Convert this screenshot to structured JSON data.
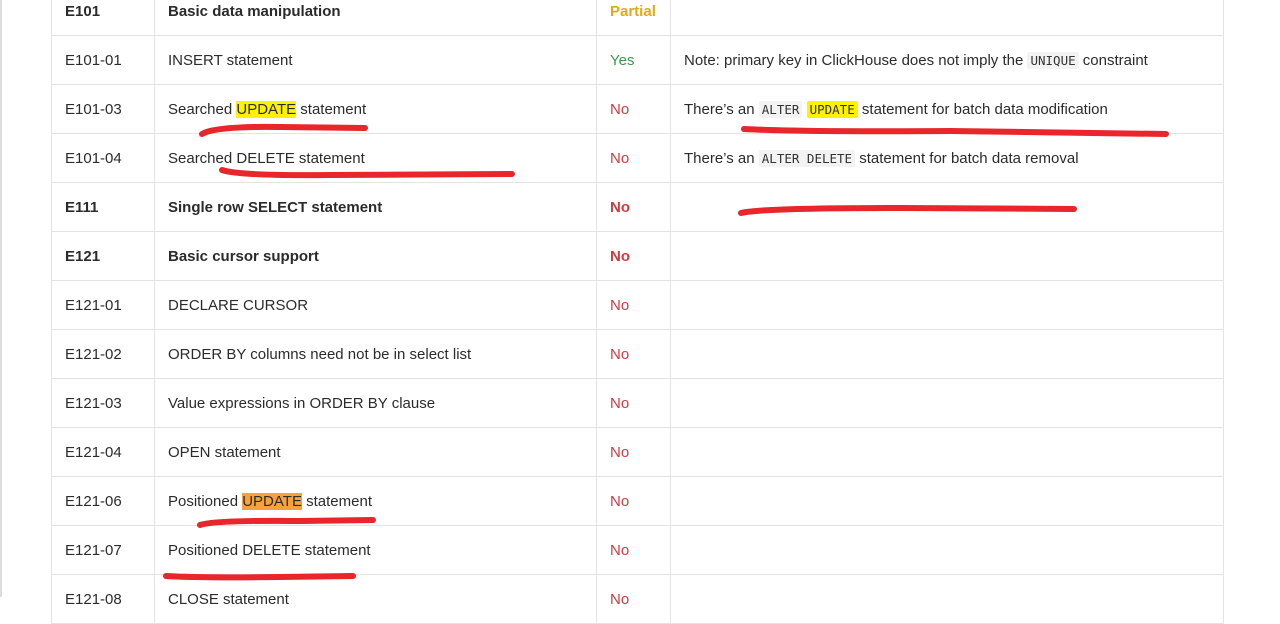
{
  "rows": [
    {
      "id": "E101",
      "feature": "Basic data manipulation",
      "status": "Partial",
      "note": "",
      "bold": true
    },
    {
      "id": "E101-01",
      "feature": "INSERT statement",
      "status": "Yes",
      "note_pre": "Note: primary key in ClickHouse does not imply the ",
      "note_code": "UNIQUE",
      "note_post": " constraint"
    },
    {
      "id": "E101-03",
      "feature_pre": "Searched ",
      "feature_hl": "UPDATE",
      "feature_post": " statement",
      "status": "No",
      "note_pre": "There’s an ",
      "note_code_a": "ALTER",
      "note_code_b": "UPDATE",
      "note_post": " statement for batch data modification"
    },
    {
      "id": "E101-04",
      "feature": "Searched DELETE statement",
      "status": "No",
      "note_pre": "There’s an ",
      "note_code": "ALTER DELETE",
      "note_post": " statement for batch data removal"
    },
    {
      "id": "E111",
      "feature": "Single row SELECT statement",
      "status": "No",
      "bold": true
    },
    {
      "id": "E121",
      "feature": "Basic cursor support",
      "status": "No",
      "bold": true
    },
    {
      "id": "E121-01",
      "feature": "DECLARE CURSOR",
      "status": "No"
    },
    {
      "id": "E121-02",
      "feature": "ORDER BY columns need not be in select list",
      "status": "No"
    },
    {
      "id": "E121-03",
      "feature": "Value expressions in ORDER BY clause",
      "status": "No"
    },
    {
      "id": "E121-04",
      "feature": "OPEN statement",
      "status": "No"
    },
    {
      "id": "E121-06",
      "feature_pre": "Positioned ",
      "feature_hl": "UPDATE",
      "feature_post": " statement",
      "status": "No"
    },
    {
      "id": "E121-07",
      "feature": "Positioned DELETE statement",
      "status": "No"
    },
    {
      "id": "E121-08",
      "feature": "CLOSE statement",
      "status": "No"
    }
  ],
  "colors": {
    "yes": "#3a9a4a",
    "no": "#d9363e",
    "partial": "#e6a817",
    "highlight_yellow": "#fff200",
    "highlight_orange": "#f7a13a",
    "annotation_red": "#e8262b"
  }
}
